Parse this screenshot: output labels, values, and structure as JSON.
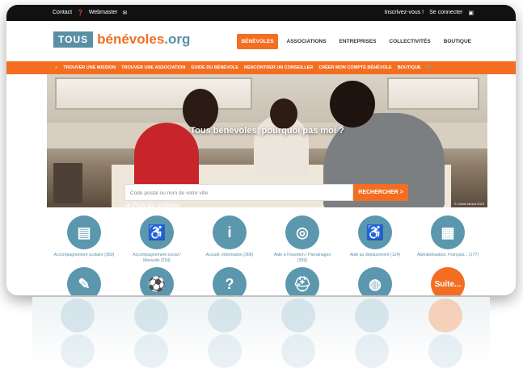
{
  "topbar": {
    "contact": "Contact",
    "webmaster": "Webmaster",
    "register": "Inscrivez-vous !",
    "login": "Se connecter"
  },
  "logo": {
    "box_text": "TOUS",
    "brand": "bénévoles",
    "suffix": ".org"
  },
  "menu": {
    "items": [
      "BÉNÉVOLES",
      "ASSOCIATIONS",
      "ENTREPRISES",
      "COLLECTIVITÉS",
      "BOUTIQUE"
    ],
    "active_index": 0
  },
  "orange_nav": {
    "items": [
      "TROUVER UNE MISSION",
      "TROUVER UNE ASSOCIATION",
      "GUIDE DU BÉNÉVOLE",
      "RENCONTRER UN CONSEILLER",
      "CRÉER MON COMPTE BÉNÉVOLE",
      "BOUTIQUE"
    ]
  },
  "hero": {
    "title": "Tous bénévoles, pourquoi pas moi ?",
    "search_placeholder": "Code postal ou nom de votre ville",
    "search_button": "RECHERCHER >",
    "more_criteria": "Plus de critères",
    "credit": "© Cécile Muzet 2015"
  },
  "categories": [
    {
      "label": "Accompagnement scolaire (360)",
      "icon": "notebook-icon"
    },
    {
      "label": "Accompagnement social / Maraude (234)",
      "icon": "helping-person-icon"
    },
    {
      "label": "Accueil, information (306)",
      "icon": "info-icon"
    },
    {
      "label": "Aide à l'insertion / Parrainages (359)",
      "icon": "lifebuoy-icon"
    },
    {
      "label": "Aide au déplacement (124)",
      "icon": "wheelchair-icon"
    },
    {
      "label": "Alphabétisation, Français... (177)",
      "icon": "book-icon"
    },
    {
      "label": "",
      "icon": "paintbrush-icon"
    },
    {
      "label": "",
      "icon": "football-icon"
    },
    {
      "label": "",
      "icon": "question-icon"
    },
    {
      "label": "",
      "icon": "helmet-icon"
    },
    {
      "label": "",
      "icon": "globe-icon"
    },
    {
      "label": "Suite...",
      "icon": "more-icon"
    }
  ],
  "colors": {
    "accent": "#f36e21",
    "blue": "#5b97ad",
    "topbar": "#111111"
  }
}
